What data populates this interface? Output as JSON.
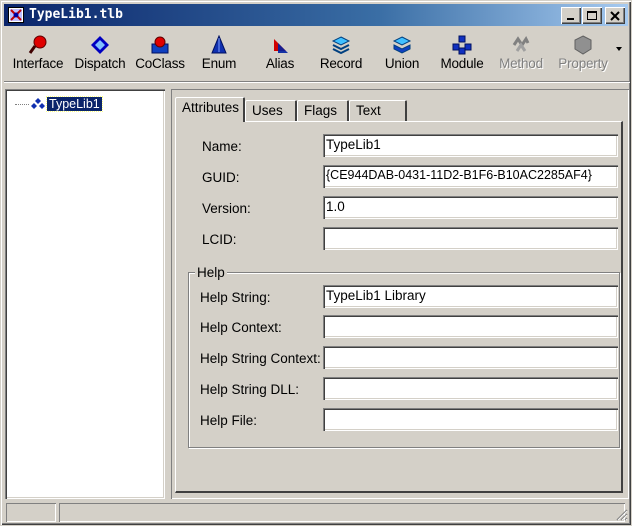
{
  "window": {
    "title": "TypeLib1.tlb",
    "minimize_icon": "minimize-icon",
    "maximize_icon": "maximize-icon",
    "close_icon": "close-icon"
  },
  "toolbar": {
    "items": [
      {
        "label": "Interface",
        "icon": "interface-icon",
        "enabled": true
      },
      {
        "label": "Dispatch",
        "icon": "dispatch-icon",
        "enabled": true
      },
      {
        "label": "CoClass",
        "icon": "coclass-icon",
        "enabled": true
      },
      {
        "label": "Enum",
        "icon": "enum-icon",
        "enabled": true
      },
      {
        "label": "Alias",
        "icon": "alias-icon",
        "enabled": true
      },
      {
        "label": "Record",
        "icon": "record-icon",
        "enabled": true
      },
      {
        "label": "Union",
        "icon": "union-icon",
        "enabled": true
      },
      {
        "label": "Module",
        "icon": "module-icon",
        "enabled": true
      },
      {
        "label": "Method",
        "icon": "method-icon",
        "enabled": false
      },
      {
        "label": "Property",
        "icon": "property-icon",
        "enabled": false
      }
    ],
    "overflow_icon": "chevron-down-icon"
  },
  "tree": {
    "root_label": "TypeLib1",
    "root_icon": "typelib-icon"
  },
  "tabs": [
    {
      "label": "Attributes",
      "active": true
    },
    {
      "label": "Uses",
      "active": false
    },
    {
      "label": "Flags",
      "active": false
    },
    {
      "label": "Text",
      "active": false
    }
  ],
  "attributes": {
    "name_label": "Name:",
    "name_value": "TypeLib1",
    "guid_label": "GUID:",
    "guid_value": "{CE944DAB-0431-11D2-B1F6-B10AC2285AF4}",
    "version_label": "Version:",
    "version_value": "1.0",
    "lcid_label": "LCID:",
    "lcid_value": ""
  },
  "help": {
    "group_title": "Help",
    "help_string_label": "Help String:",
    "help_string_value": "TypeLib1 Library",
    "help_context_label": "Help Context:",
    "help_context_value": "",
    "help_string_context_label": "Help String Context:",
    "help_string_context_value": "",
    "help_string_dll_label": "Help String DLL:",
    "help_string_dll_value": "",
    "help_file_label": "Help File:",
    "help_file_value": ""
  },
  "colors": {
    "title_active": "#0a246a",
    "face": "#d4d0c8",
    "selection": "#0a246a",
    "disabled_text": "#808080"
  }
}
